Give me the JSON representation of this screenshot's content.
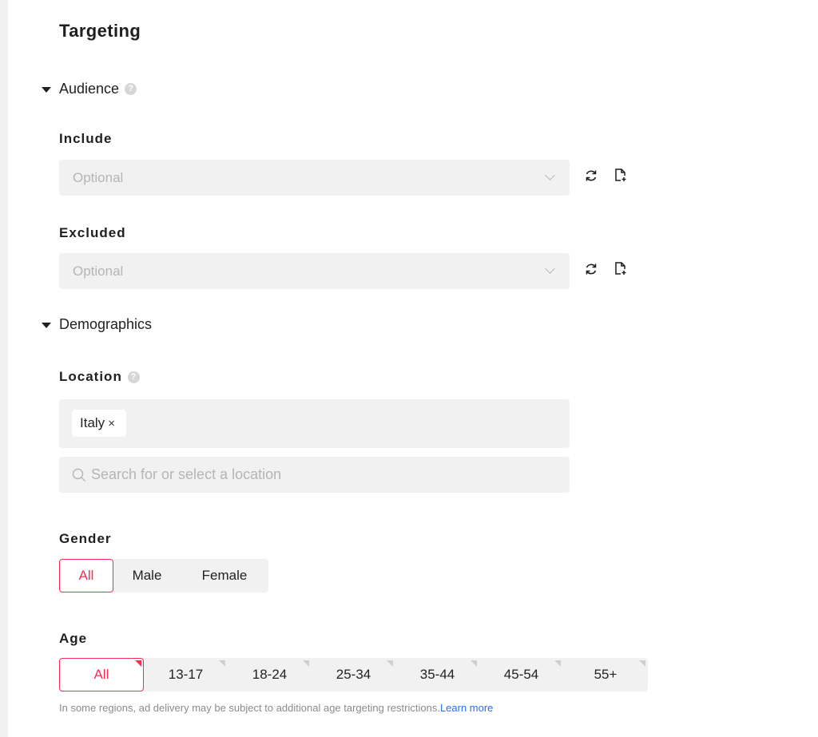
{
  "page": {
    "title": "Targeting"
  },
  "audience": {
    "section_label": "Audience",
    "help_icon": "question-circle-icon",
    "include": {
      "label": "Include",
      "placeholder": "Optional",
      "icons": [
        "refresh-icon",
        "file-add-icon"
      ]
    },
    "excluded": {
      "label": "Excluded",
      "placeholder": "Optional",
      "icons": [
        "refresh-icon",
        "file-add-icon"
      ]
    }
  },
  "demographics": {
    "section_label": "Demographics",
    "location": {
      "label": "Location",
      "help_icon": "question-circle-icon",
      "selected": [
        "Italy"
      ],
      "remove_glyph": "×",
      "search_placeholder": "Search for or select a location"
    },
    "gender": {
      "label": "Gender",
      "options": [
        "All",
        "Male",
        "Female"
      ],
      "selected": "All"
    },
    "age": {
      "label": "Age",
      "options": [
        "All",
        "13-17",
        "18-24",
        "25-34",
        "35-44",
        "45-54",
        "55+"
      ],
      "selected": "All",
      "note": "In some regions, ad delivery may be subject to additional age targeting restrictions.",
      "learn_more": "Learn more"
    }
  },
  "colors": {
    "accent": "#fe2c55",
    "link": "#2a6df4",
    "field_bg": "#f1f1f2"
  }
}
